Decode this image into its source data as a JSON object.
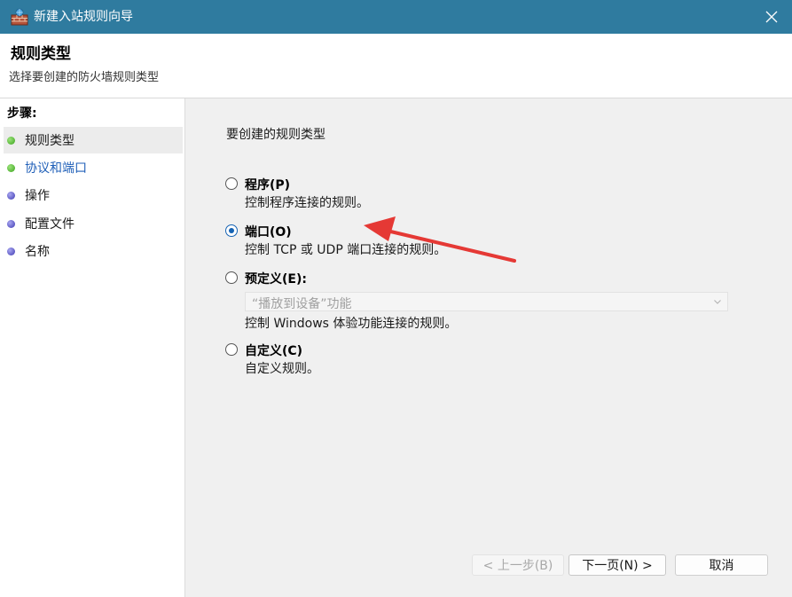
{
  "window": {
    "title": "新建入站规则向导"
  },
  "header": {
    "title": "规则类型",
    "subtitle": "选择要创建的防火墙规则类型"
  },
  "steps": {
    "heading": "步骤:",
    "items": [
      {
        "label": "规则类型",
        "state": "current"
      },
      {
        "label": "协议和端口",
        "state": "done"
      },
      {
        "label": "操作",
        "state": "pending"
      },
      {
        "label": "配置文件",
        "state": "pending"
      },
      {
        "label": "名称",
        "state": "pending"
      }
    ]
  },
  "content": {
    "prompt": "要创建的规则类型",
    "options": [
      {
        "label": "程序(P)",
        "desc": "控制程序连接的规则。",
        "checked": false
      },
      {
        "label": "端口(O)",
        "desc": "控制 TCP 或 UDP 端口连接的规则。",
        "checked": true
      },
      {
        "label": "预定义(E):",
        "desc": "控制 Windows 体验功能连接的规则。",
        "checked": false
      },
      {
        "label": "自定义(C)",
        "desc": "自定义规则。",
        "checked": false
      }
    ],
    "predefined_select": {
      "value": "“播放到设备”功能"
    }
  },
  "buttons": {
    "back": "< 上一步(B)",
    "next": "下一页(N) >",
    "cancel": "取消"
  },
  "colors": {
    "titlebar": "#2f7b9f",
    "accent": "#1462b3",
    "annotation": "#e53935"
  }
}
